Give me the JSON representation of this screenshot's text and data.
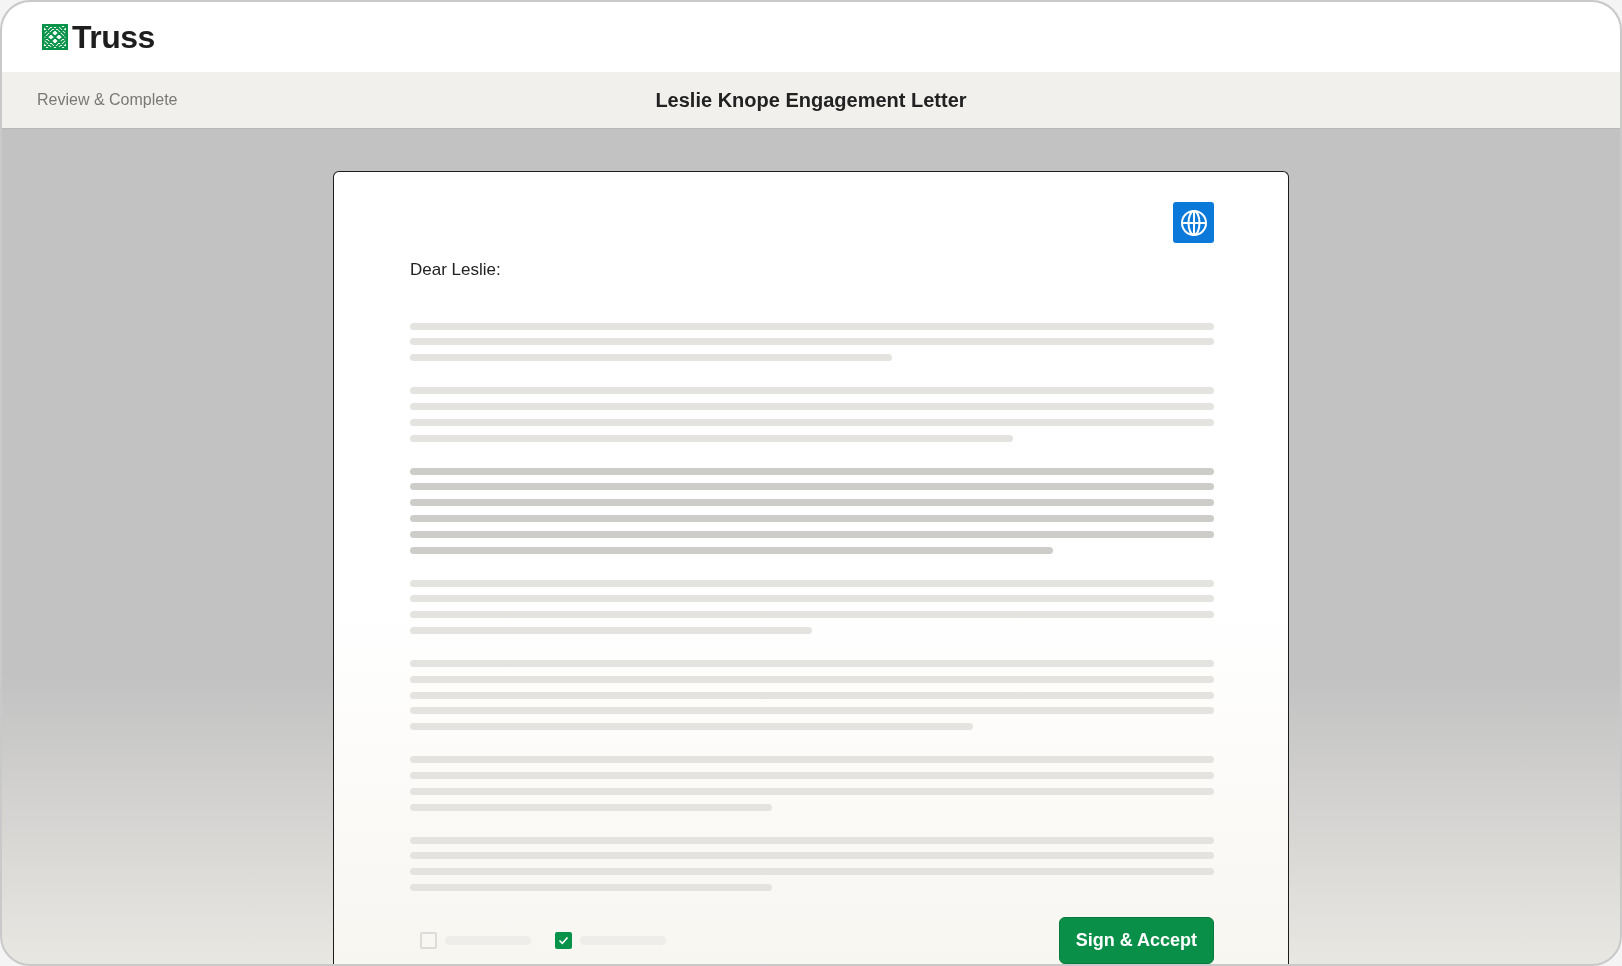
{
  "brand": {
    "name": "Truss"
  },
  "breadcrumb": "Review & Complete",
  "title": "Leslie Knope Engagement Letter",
  "letter": {
    "greeting": "Dear Leslie:"
  },
  "consents": [
    {
      "checked": false
    },
    {
      "checked": true
    }
  ],
  "primary_button": "Sign & Accept"
}
